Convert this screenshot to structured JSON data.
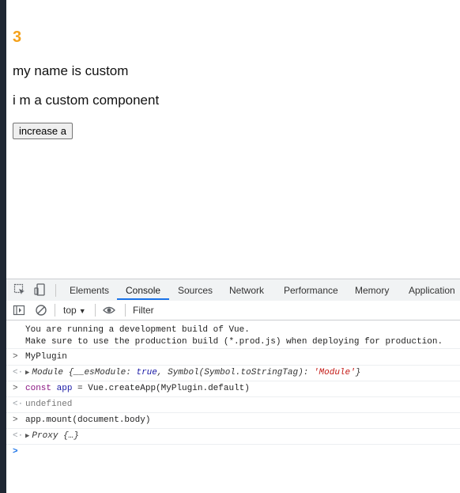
{
  "page": {
    "count": "3",
    "line1": "my name is custom",
    "line2": "i m a custom component",
    "button_label": "increase a"
  },
  "devtools": {
    "tabs": [
      "Elements",
      "Console",
      "Sources",
      "Network",
      "Performance",
      "Memory",
      "Application"
    ],
    "active_tab": "Console",
    "context": "top",
    "filter_placeholder": "Filter",
    "icons": [
      "inspect-icon",
      "device-toolbar-icon",
      "sidebar-toggle-icon",
      "clear-console-icon",
      "eye-icon"
    ],
    "accent_color": "#1a73e8"
  },
  "console": {
    "warning_line1": "You are running a development build of Vue.",
    "warning_line2": "Make sure to use the production build (*.prod.js) when deploying for production.",
    "entries": [
      {
        "type": "input",
        "text": "MyPlugin"
      },
      {
        "type": "output",
        "obj": "Module",
        "brace_open": "{",
        "key1": "__esModule",
        "colon1": ": ",
        "val1": "true",
        "sep": ", ",
        "key2": "Symbol(Symbol.toStringTag)",
        "colon2": ": ",
        "val2": "'Module'",
        "brace_close": "}"
      },
      {
        "type": "input",
        "kw": "const",
        "var": "app",
        "rest": " = Vue.createApp(MyPlugin.default)"
      },
      {
        "type": "output",
        "text": "undefined"
      },
      {
        "type": "input",
        "text": "app.mount(document.body)"
      },
      {
        "type": "output",
        "obj": "Proxy",
        "body": "{…}"
      }
    ],
    "prompt_glyph": ">",
    "result_glyph": "<·"
  }
}
